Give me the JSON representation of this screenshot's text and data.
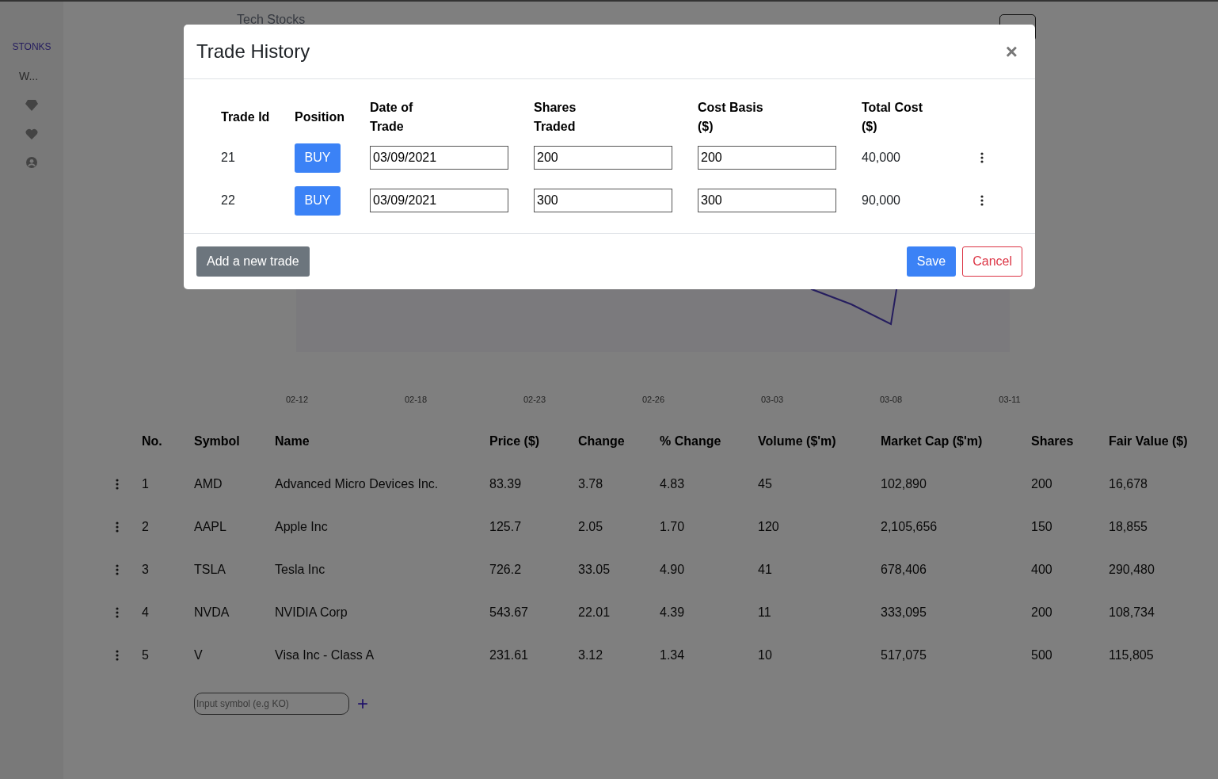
{
  "sidebar": {
    "brand": "STONKS",
    "items": [
      {
        "label": "W..."
      }
    ]
  },
  "page_title": "Tech Stocks",
  "chart": {
    "x_labels": [
      "02-12",
      "02-18",
      "02-23",
      "02-26",
      "03-03",
      "03-08",
      "03-11"
    ]
  },
  "table": {
    "columns": [
      "No.",
      "Symbol",
      "Name",
      "Price ($)",
      "Change",
      "% Change",
      "Volume ($'m)",
      "Market Cap ($'m)",
      "Shares",
      "Fair Value ($)"
    ],
    "rows": [
      [
        "1",
        "AMD",
        "Advanced Micro Devices Inc.",
        "83.39",
        "3.78",
        "4.83",
        "45",
        "102,890",
        "200",
        "16,678"
      ],
      [
        "2",
        "AAPL",
        "Apple Inc",
        "125.7",
        "2.05",
        "1.70",
        "120",
        "2,105,656",
        "150",
        "18,855"
      ],
      [
        "3",
        "TSLA",
        "Tesla Inc",
        "726.2",
        "33.05",
        "4.90",
        "41",
        "678,406",
        "400",
        "290,480"
      ],
      [
        "4",
        "NVDA",
        "NVIDIA Corp",
        "543.67",
        "22.01",
        "4.39",
        "11",
        "333,095",
        "200",
        "108,734"
      ],
      [
        "5",
        "V",
        "Visa Inc - Class A",
        "231.61",
        "3.12",
        "1.34",
        "10",
        "517,075",
        "500",
        "115,805"
      ]
    ]
  },
  "add_symbol": {
    "placeholder": "Input symbol (e.g KO)",
    "button": "+"
  },
  "modal": {
    "title": "Trade History",
    "close": "×",
    "columns": [
      "Trade Id",
      "Position",
      "Date of Trade",
      "Shares Traded",
      "Cost Basis ($)",
      "Total Cost ($)"
    ],
    "rows": [
      {
        "id": "21",
        "position": "BUY",
        "date": "03/09/2021",
        "shares": "200",
        "cost_basis": "200",
        "total": "40,000"
      },
      {
        "id": "22",
        "position": "BUY",
        "date": "03/09/2021",
        "shares": "300",
        "cost_basis": "300",
        "total": "90,000"
      }
    ],
    "add_button": "Add a new trade",
    "save_button": "Save",
    "cancel_button": "Cancel"
  }
}
